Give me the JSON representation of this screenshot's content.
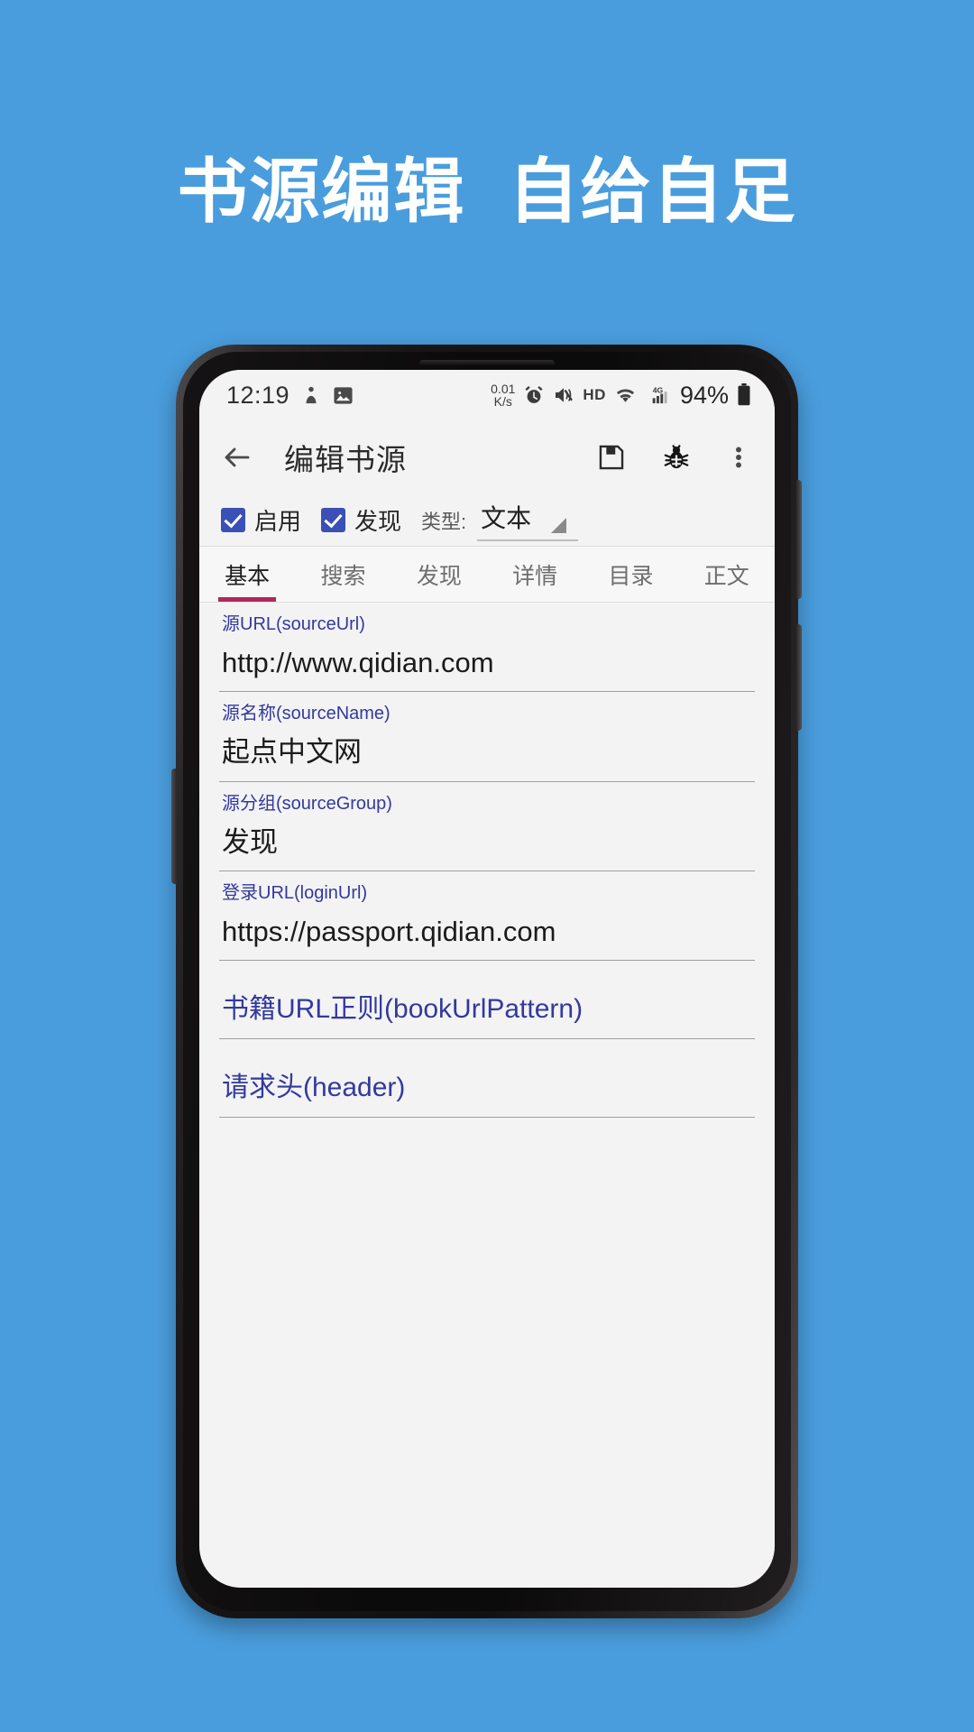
{
  "promo": {
    "headline": "书源编辑  自给自足",
    "background_color": "#4a9ddd",
    "text_color": "#ffffff"
  },
  "phone": {
    "status_bar": {
      "time": "12:19",
      "left_icons": [
        "download-manager-icon",
        "screenshot-image-icon"
      ],
      "net_speed_value": "0.01",
      "net_speed_unit": "K/s",
      "right_icons": [
        "alarm-icon",
        "mute-icon",
        "hd-icon",
        "wifi-icon",
        "signal-4g-icon",
        "battery-icon"
      ],
      "hd_label": "HD",
      "network_label": "4G",
      "battery_percent": "94%"
    },
    "app_bar": {
      "back_icon": "back-arrow-icon",
      "title": "编辑书源",
      "actions": [
        {
          "name": "save",
          "icon": "floppy-save-icon"
        },
        {
          "name": "debug",
          "icon": "bug-debug-icon"
        },
        {
          "name": "more",
          "icon": "overflow-menu-icon"
        }
      ]
    },
    "options": {
      "enable": {
        "label": "启用",
        "checked": true
      },
      "discover": {
        "label": "发现",
        "checked": true
      },
      "type_label": "类型:",
      "type_value": "文本",
      "checkbox_color": "#3a50b5"
    },
    "tabs": {
      "active_index": 0,
      "indicator_color": "#b0275a",
      "items": [
        {
          "label": "基本"
        },
        {
          "label": "搜索"
        },
        {
          "label": "发现"
        },
        {
          "label": "详情"
        },
        {
          "label": "目录"
        },
        {
          "label": "正文"
        }
      ]
    },
    "form": {
      "label_color": "#33399e",
      "fields": [
        {
          "label": "源URL(sourceUrl)",
          "value": "http://www.qidian.com",
          "empty": false
        },
        {
          "label": "源名称(sourceName)",
          "value": "起点中文网",
          "empty": false
        },
        {
          "label": "源分组(sourceGroup)",
          "value": "发现",
          "empty": false
        },
        {
          "label": "登录URL(loginUrl)",
          "value": "https://passport.qidian.com",
          "empty": false
        },
        {
          "label": "书籍URL正则(bookUrlPattern)",
          "value": "",
          "empty": true
        },
        {
          "label": "请求头(header)",
          "value": "",
          "empty": true
        }
      ]
    }
  }
}
